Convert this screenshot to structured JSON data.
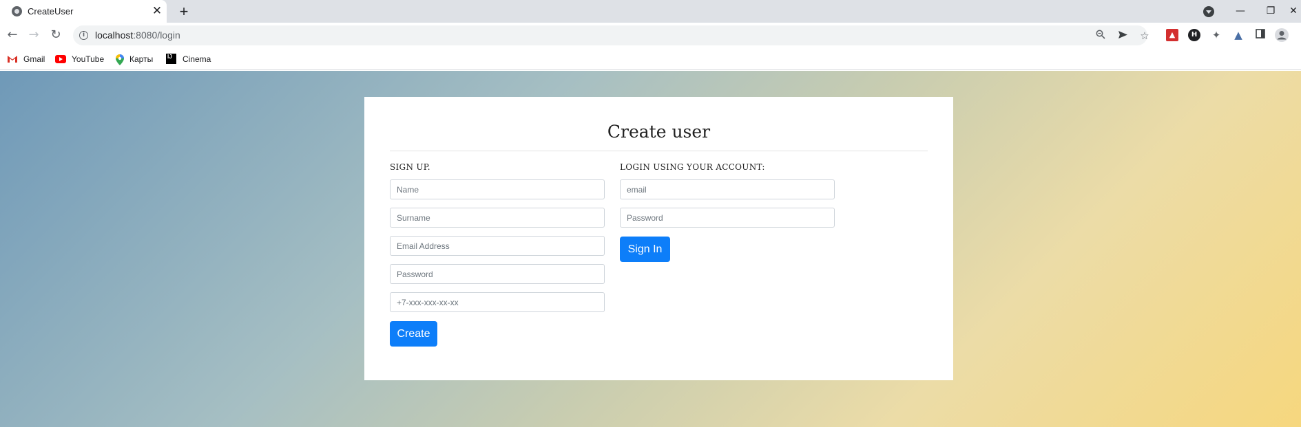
{
  "browser": {
    "tab_title": "CreateUser",
    "tab_close": "✕",
    "new_tab": "+",
    "url_host": "localhost",
    "url_path": ":8080/login",
    "window_controls": {
      "minimize": "—",
      "restore": "❐",
      "close": "✕"
    }
  },
  "bookmarks": [
    {
      "label": "Gmail",
      "icon": "gmail-icon"
    },
    {
      "label": "YouTube",
      "icon": "youtube-icon"
    },
    {
      "label": "Карты",
      "icon": "maps-icon"
    },
    {
      "label": "Cinema",
      "icon": "intellij-icon"
    }
  ],
  "page": {
    "title": "Create user",
    "signup": {
      "heading": "SIGN UP.",
      "name_placeholder": "Name",
      "surname_placeholder": "Surname",
      "email_placeholder": "Email Address",
      "password_placeholder": "Password",
      "phone_placeholder": "+7-xxx-xxx-xx-xx",
      "submit_label": "Create"
    },
    "login": {
      "heading": "LOGIN USING YOUR ACCOUNT:",
      "email_placeholder": "email",
      "password_placeholder": "Password",
      "submit_label": "Sign In"
    }
  },
  "colors": {
    "primary_button": "#0d7ef9",
    "background_start": "#6f99b8",
    "background_end": "#f6d77e"
  }
}
